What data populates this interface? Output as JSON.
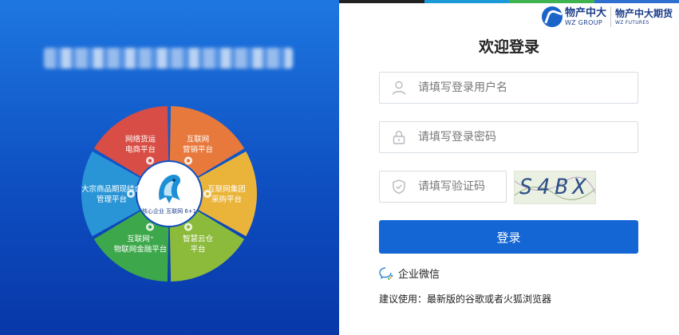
{
  "left_panel": {
    "wheel": {
      "center_label": "核心企业 互联网 6+1",
      "segments": [
        {
          "line1": "互联网",
          "line2": "营销平台",
          "color": "#e8793c"
        },
        {
          "line1": "互联网集团",
          "line2": "采购平台",
          "color": "#eab43a"
        },
        {
          "line1": "智慧云仓",
          "line2": "平台",
          "color": "#8cbb3c"
        },
        {
          "line1": "互联网⁺",
          "line2": "物联网金融平台",
          "color": "#3da84b"
        },
        {
          "line1": "大宗商品期现结合",
          "line2": "管理平台",
          "color": "#2a95d6"
        },
        {
          "line1": "网络货运",
          "line2": "电商平台",
          "color": "#d84e46"
        }
      ]
    }
  },
  "brand": {
    "group_cn": "物产中大",
    "group_en": "WZ GROUP",
    "futures_cn": "物产中大期货",
    "futures_en": "WZ FUTURES",
    "top_colors": [
      "#222222",
      "#1a9ad6",
      "#3fb34f",
      "#2f6fd0"
    ]
  },
  "login": {
    "title": "欢迎登录",
    "username_placeholder": "请填写登录用户名",
    "password_placeholder": "请填写登录密码",
    "captcha_placeholder": "请填写验证码",
    "captcha_text": "S4BX",
    "submit_label": "登录",
    "wechat_label": "企业微信",
    "browser_hint": "建议使用：最新版的谷歌或者火狐浏览器"
  }
}
